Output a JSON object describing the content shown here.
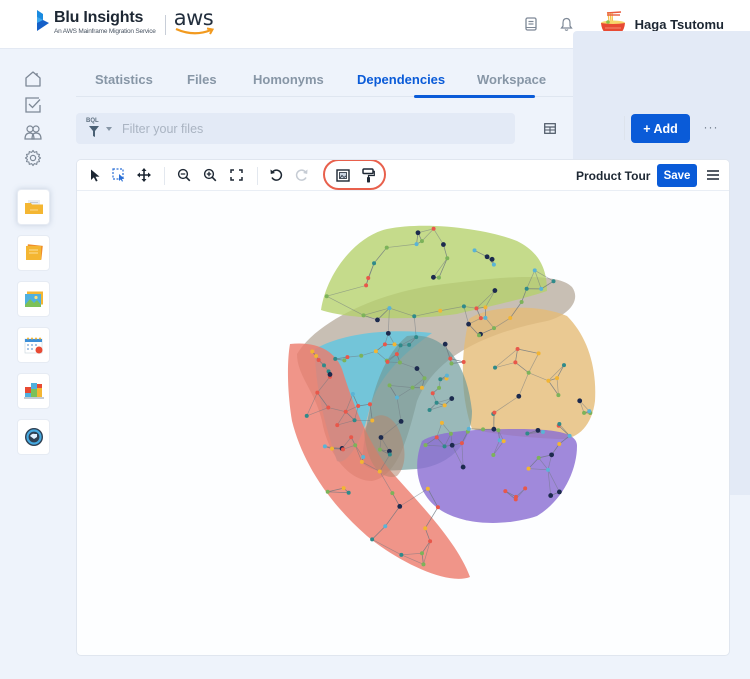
{
  "header": {
    "app_name": "Blu Insights",
    "app_tagline": "An AWS Mainframe Migration Service",
    "partner_logo": "aws",
    "icons": [
      "book-icon",
      "bell-icon"
    ],
    "user": {
      "name": "Haga Tsutomu",
      "avatar": "ramen-bowl-avatar"
    }
  },
  "rail": {
    "nav_icons": [
      "home-icon",
      "checklist-icon",
      "users-icon",
      "gear-icon"
    ],
    "apps": [
      {
        "name": "folder-app",
        "icon": "folder-icon",
        "active": true
      },
      {
        "name": "notes-app",
        "icon": "sticky-notes-icon",
        "active": false
      },
      {
        "name": "gallery-app",
        "icon": "picture-icon",
        "active": false
      },
      {
        "name": "calendar-app",
        "icon": "calendar-icon",
        "active": false
      },
      {
        "name": "dashboard-app",
        "icon": "dashboard-icon",
        "active": false
      },
      {
        "name": "sync-app",
        "icon": "sync-icon",
        "active": false
      }
    ]
  },
  "tabs": [
    {
      "label": "Statistics",
      "active": false
    },
    {
      "label": "Files",
      "active": false
    },
    {
      "label": "Homonyms",
      "active": false
    },
    {
      "label": "Dependencies",
      "active": true
    },
    {
      "label": "Workspace",
      "active": false
    }
  ],
  "filter": {
    "bql_label": "BQL",
    "placeholder": "Filter your files",
    "value": ""
  },
  "actions": {
    "table_view": "table-icon",
    "graph_view": "graph-icon",
    "add_label": "+ Add",
    "more_label": "···"
  },
  "toolbar": {
    "tools": [
      "select-pointer",
      "box-select",
      "move",
      "zoom-out",
      "zoom-in",
      "fit-screen",
      "undo",
      "redo",
      "frame-select",
      "paint-roller"
    ],
    "highlighted": [
      "frame-select",
      "paint-roller"
    ],
    "product_tour_label": "Product Tour",
    "save_label": "Save",
    "menu": "hamburger-menu"
  },
  "graph": {
    "type": "dependency-graph",
    "clusters": [
      {
        "name": "green-cluster",
        "color": "#b5d16a"
      },
      {
        "name": "gray-cluster",
        "color": "#b8ad9f"
      },
      {
        "name": "cyan-cluster",
        "color": "#5bc6e3"
      },
      {
        "name": "orange-cluster",
        "color": "#e5bb77"
      },
      {
        "name": "red-cluster",
        "color": "#ec7a6c"
      },
      {
        "name": "teal-cluster",
        "color": "#6f9b9b"
      },
      {
        "name": "purple-cluster",
        "color": "#8b6fd3"
      }
    ],
    "node_colors": [
      "#e8574a",
      "#5ab4d6",
      "#f2b533",
      "#7cb35a",
      "#1c2a4e",
      "#2f8a8a"
    ]
  }
}
